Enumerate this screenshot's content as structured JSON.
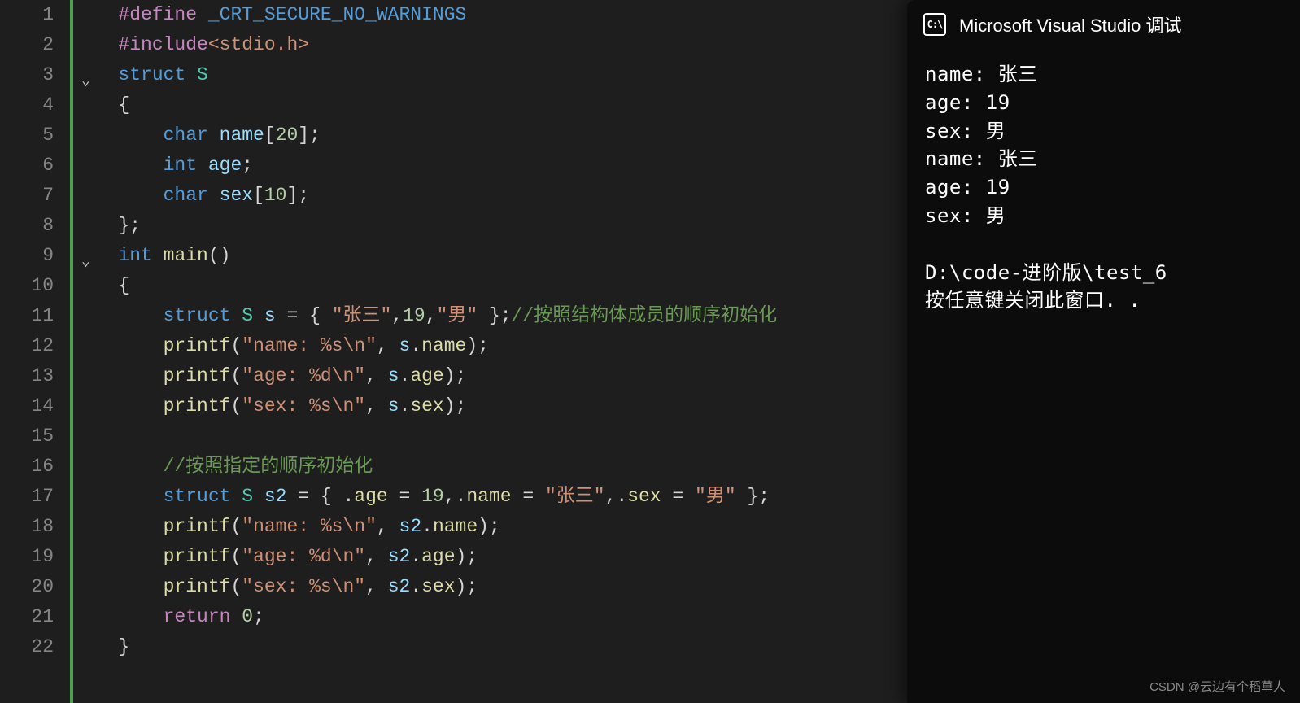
{
  "line_numbers": [
    "1",
    "2",
    "3",
    "4",
    "5",
    "6",
    "7",
    "8",
    "9",
    "10",
    "11",
    "12",
    "13",
    "14",
    "15",
    "16",
    "17",
    "18",
    "19",
    "20",
    "21",
    "22"
  ],
  "code": {
    "l1": {
      "pp": "#define ",
      "macro": "_CRT_SECURE_NO_WARNINGS"
    },
    "l2": {
      "pp": "#include",
      "inc": "<stdio.h>"
    },
    "l3": {
      "kw": "struct ",
      "type": "S"
    },
    "l4": {
      "brace": "{"
    },
    "l5": {
      "kw": "char ",
      "var": "name",
      "arr": "[",
      "num": "20",
      "arr2": "];"
    },
    "l6": {
      "kw": "int ",
      "var": "age",
      "end": ";"
    },
    "l7": {
      "kw": "char ",
      "var": "sex",
      "arr": "[",
      "num": "10",
      "arr2": "];"
    },
    "l8": {
      "brace": "};"
    },
    "l9": {
      "kw": "int ",
      "func": "main",
      "paren": "()"
    },
    "l10": {
      "brace": "{"
    },
    "l11": {
      "kw": "struct ",
      "type": "S ",
      "var": "s ",
      "eq": "= { ",
      "str1": "\"张三\"",
      "c1": ",",
      "num1": "19",
      "c2": ",",
      "str2": "\"男\" ",
      "close": "};",
      "comm": "//按照结构体成员的顺序初始化"
    },
    "l12": {
      "func": "printf",
      "open": "(",
      "str": "\"name: %s\\n\"",
      "comma": ", ",
      "obj": "s",
      "dot": ".",
      "mem": "name",
      "close": ");"
    },
    "l13": {
      "func": "printf",
      "open": "(",
      "str": "\"age: %d\\n\"",
      "comma": ", ",
      "obj": "s",
      "dot": ".",
      "mem": "age",
      "close": ");"
    },
    "l14": {
      "func": "printf",
      "open": "(",
      "str": "\"sex: %s\\n\"",
      "comma": ", ",
      "obj": "s",
      "dot": ".",
      "mem": "sex",
      "close": ");"
    },
    "l16": {
      "comm": "//按照指定的顺序初始化"
    },
    "l17": {
      "kw": "struct ",
      "type": "S ",
      "var": "s2 ",
      "eq": "= { .",
      "m1": "age ",
      "e1": "= ",
      "n1": "19",
      "c1": ",.",
      "m2": "name ",
      "e2": "= ",
      "s1": "\"张三\"",
      "c2": ",.",
      "m3": "sex ",
      "e3": "= ",
      "s2": "\"男\" ",
      "close": "};"
    },
    "l18": {
      "func": "printf",
      "open": "(",
      "str": "\"name: %s\\n\"",
      "comma": ", ",
      "obj": "s2",
      "dot": ".",
      "mem": "name",
      "close": ");"
    },
    "l19": {
      "func": "printf",
      "open": "(",
      "str": "\"age: %d\\n\"",
      "comma": ", ",
      "obj": "s2",
      "dot": ".",
      "mem": "age",
      "close": ");"
    },
    "l20": {
      "func": "printf",
      "open": "(",
      "str": "\"sex: %s\\n\"",
      "comma": ", ",
      "obj": "s2",
      "dot": ".",
      "mem": "sex",
      "close": ");"
    },
    "l21": {
      "kw": "return ",
      "num": "0",
      "end": ";"
    },
    "l22": {
      "brace": "}"
    }
  },
  "console": {
    "icon_text": "C:\\",
    "title": "Microsoft Visual Studio 调试",
    "lines": [
      "name: 张三",
      "age: 19",
      "sex: 男",
      "name: 张三",
      "age: 19",
      "sex: 男",
      "",
      "D:\\code-进阶版\\test_6",
      "按任意键关闭此窗口. ."
    ]
  },
  "watermark": "CSDN @云边有个稻草人"
}
